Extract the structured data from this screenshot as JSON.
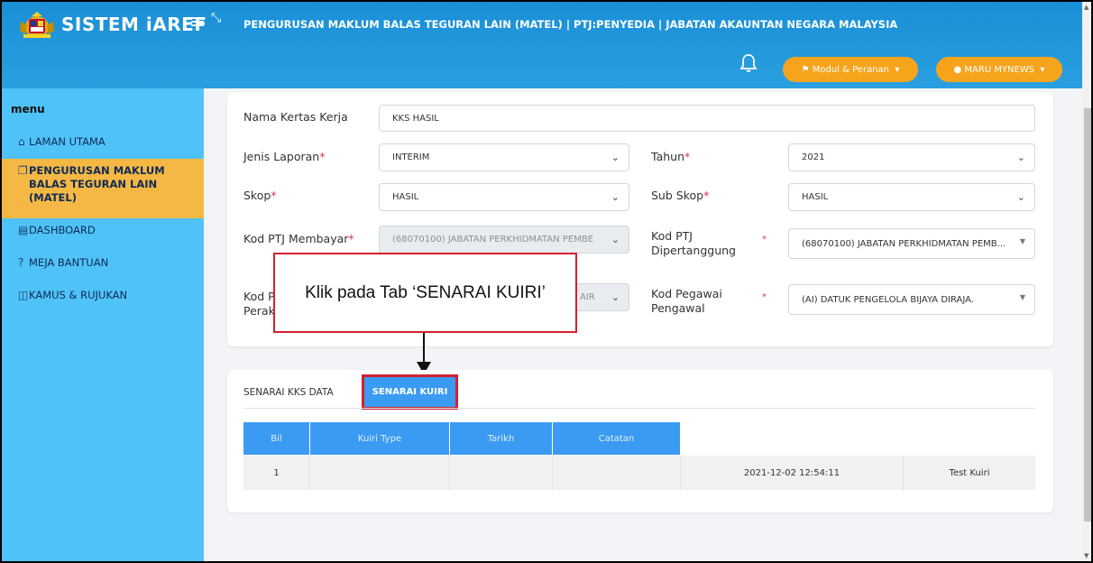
{
  "header": {
    "brand": "SISTEM iAREF",
    "menu_icon": "≡",
    "expand_icon": "⤡",
    "title": "PENGURUSAN MAKLUM BALAS TEGURAN LAIN (MATEL) | PTJ:PENYEDIA | JABATAN AKAUNTAN NEGARA MALAYSIA",
    "modul_button": "Modul & Peranan",
    "user_button": "MARU MYNEWS",
    "accent": "#f7a41d",
    "background": "#1a8fd6"
  },
  "sidebar": {
    "heading": "menu",
    "background": "#4fc3f7",
    "items": [
      {
        "icon": "home-icon",
        "glyph": "⌂",
        "label": "LAMAN UTAMA"
      },
      {
        "icon": "copy-icon",
        "glyph": "❐",
        "label": "PENGURUSAN MAKLUM BALAS TEGURAN LAIN (MATEL)",
        "active": true
      },
      {
        "icon": "dashboard-icon",
        "glyph": "▤",
        "label": "DASHBOARD"
      },
      {
        "icon": "help-icon",
        "glyph": "?",
        "label": "MEJA BANTUAN"
      },
      {
        "icon": "book-icon",
        "glyph": "◫",
        "label": "KAMUS & RUJUKAN"
      }
    ]
  },
  "form": {
    "nama_kertas_kerja": {
      "label": "Nama Kertas Kerja",
      "value": "KKS HASIL"
    },
    "jenis_laporan": {
      "label": "Jenis Laporan",
      "value": "INTERIM"
    },
    "tahun": {
      "label": "Tahun",
      "value": "2021"
    },
    "skop": {
      "label": "Skop",
      "value": "HASIL"
    },
    "sub_skop": {
      "label": "Sub Skop",
      "value": "HASIL"
    },
    "kod_ptj_membayar": {
      "label": "Kod PTJ Membayar",
      "value": "(68070100) JABATAN PERKHIDMATAN PEMBE"
    },
    "kod_ptj_dipertanggung": {
      "label": "Kod PTJ Dipertanggung",
      "value": "(68070100) JABATAN PERKHIDMATAN PEMB..."
    },
    "kod_pegawai_perakuan": {
      "label": "Kod Pegawai Perakuan",
      "label_visible_1": "Kod P",
      "label_visible_2": "Perak",
      "value": "AIR"
    },
    "kod_pegawai_pengawal": {
      "label": "Kod Pegawai Pengawal",
      "value": "(AI) DATUK PENGELOLA BIJAYA DIRAJA."
    },
    "required_mark": "*"
  },
  "tabs": {
    "senarai_kks_data": "SENARAI KKS DATA",
    "senarai_kuiri": "SENARAI KUIRI"
  },
  "table": {
    "headers": [
      "Bil",
      "Kuiri Type",
      "Tarikh",
      "Catatan"
    ],
    "rows": [
      {
        "bil": "1",
        "kuiri_type": "",
        "tarikh": "",
        "catatan": "",
        "timestamp": "2021-12-02 12:54:11",
        "note": "Test Kuiri"
      }
    ],
    "header_color": "#3b9bf2"
  },
  "callout": {
    "text": "Klik pada Tab ‘SENARAI KUIRI’",
    "border_color": "#d2202f"
  }
}
